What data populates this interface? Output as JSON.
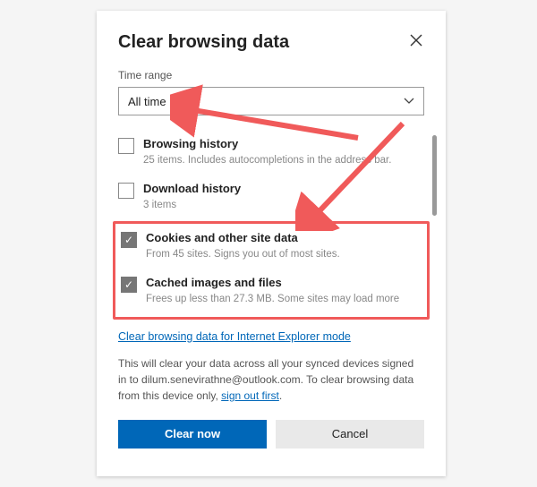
{
  "dialog": {
    "title": "Clear browsing data",
    "timeRangeLabel": "Time range",
    "timeRangeValue": "All time"
  },
  "items": [
    {
      "title": "Browsing history",
      "desc": "25 items. Includes autocompletions in the address bar.",
      "checked": false
    },
    {
      "title": "Download history",
      "desc": "3 items",
      "checked": false
    },
    {
      "title": "Cookies and other site data",
      "desc": "From 45 sites. Signs you out of most sites.",
      "checked": true
    },
    {
      "title": "Cached images and files",
      "desc": "Frees up less than 27.3 MB. Some sites may load more",
      "checked": true
    }
  ],
  "ieLink": "Clear browsing data for Internet Explorer mode",
  "info": {
    "prefix": "This will clear your data across all your synced devices signed in to dilum.senevirathne@outlook.com. To clear browsing data from this device only, ",
    "linkText": "sign out first",
    "suffix": "."
  },
  "buttons": {
    "clear": "Clear now",
    "cancel": "Cancel"
  }
}
